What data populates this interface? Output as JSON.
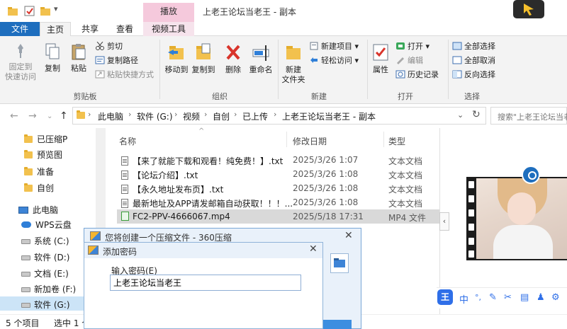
{
  "window": {
    "title": "上老王论坛当老王 - 副本",
    "context_tab": "播放"
  },
  "ribbon_tabs": {
    "file": "文件",
    "home": "主页",
    "share": "共享",
    "view": "查看",
    "video_tools": "视频工具"
  },
  "ribbon": {
    "pin_quick_access": "固定到\n快速访问",
    "copy": "复制",
    "paste": "粘贴",
    "cut": "剪切",
    "copy_path": "复制路径",
    "paste_shortcut": "粘贴快捷方式",
    "move_to": "移动到",
    "copy_to": "复制到",
    "delete": "删除",
    "rename": "重命名",
    "new_folder": "新建\n文件夹",
    "new_item": "新建项目",
    "easy_access": "轻松访问",
    "properties": "属性",
    "open": "打开",
    "edit": "编辑",
    "history": "历史记录",
    "select_all": "全部选择",
    "select_none": "全部取消",
    "invert_selection": "反向选择",
    "groups": {
      "clipboard": "剪贴板",
      "organize": "组织",
      "new": "新建",
      "open": "打开",
      "select": "选择"
    }
  },
  "address": {
    "crumbs": [
      "此电脑",
      "软件 (G:)",
      "视频",
      "自创",
      "已上传",
      "上老王论坛当老王 - 副本"
    ],
    "search_placeholder": "搜索\"上老王论坛当老"
  },
  "nav_pane": {
    "items": [
      {
        "label": "已压缩P",
        "icon": "folder-icon"
      },
      {
        "label": "预览图",
        "icon": "folder-icon"
      },
      {
        "label": "准备",
        "icon": "folder-icon"
      },
      {
        "label": "自创",
        "icon": "folder-icon"
      },
      {
        "label": "此电脑",
        "icon": "computer-icon"
      },
      {
        "label": "WPS云盘",
        "icon": "cloud-icon"
      },
      {
        "label": "系统 (C:)",
        "icon": "drive-icon"
      },
      {
        "label": "软件 (D:)",
        "icon": "drive-icon"
      },
      {
        "label": "文档 (E:)",
        "icon": "drive-icon"
      },
      {
        "label": "新加卷 (F:)",
        "icon": "drive-icon"
      },
      {
        "label": "软件 (G:)",
        "icon": "drive-icon"
      }
    ]
  },
  "file_list": {
    "columns": {
      "name": "名称",
      "modified": "修改日期",
      "type": "类型"
    },
    "rows": [
      {
        "name": "【来了就能下载和观看！纯免费！】.txt",
        "modified": "2025/3/26 1:07",
        "type": "文本文档",
        "icon": "txt-file-icon"
      },
      {
        "name": "【论坛介绍】.txt",
        "modified": "2025/3/26 1:08",
        "type": "文本文档",
        "icon": "txt-file-icon"
      },
      {
        "name": "【永久地址发布页】.txt",
        "modified": "2025/3/26 1:08",
        "type": "文本文档",
        "icon": "txt-file-icon"
      },
      {
        "name": "最新地址及APP请发邮箱自动获取！！！...",
        "modified": "2025/3/26 1:08",
        "type": "文本文档",
        "icon": "txt-file-icon"
      },
      {
        "name": "FC2-PPV-4666067.mp4",
        "modified": "2025/5/18 17:31",
        "type": "MP4 文件",
        "icon": "mp4-file-icon"
      }
    ]
  },
  "preview": {
    "collapse_glyph": "‹"
  },
  "ime_toolbar": {
    "logo": "王",
    "mode": "中",
    "punct": "°,"
  },
  "status": {
    "item_count": "5 个项目",
    "selected": "选中 1 个"
  },
  "dialog_360": {
    "title": "您将创建一个压缩文件 - 360压缩",
    "close": "✕"
  },
  "dialog_password": {
    "title": "添加密码",
    "close": "✕",
    "label": "输入密码(E)",
    "value": "上老王论坛当老王"
  },
  "colors": {
    "accent_blue": "#1e6ebe",
    "context_tab_pink": "#f5c9dc",
    "selection_blue": "#cce4f7",
    "ime_blue": "#2f6fe8"
  }
}
